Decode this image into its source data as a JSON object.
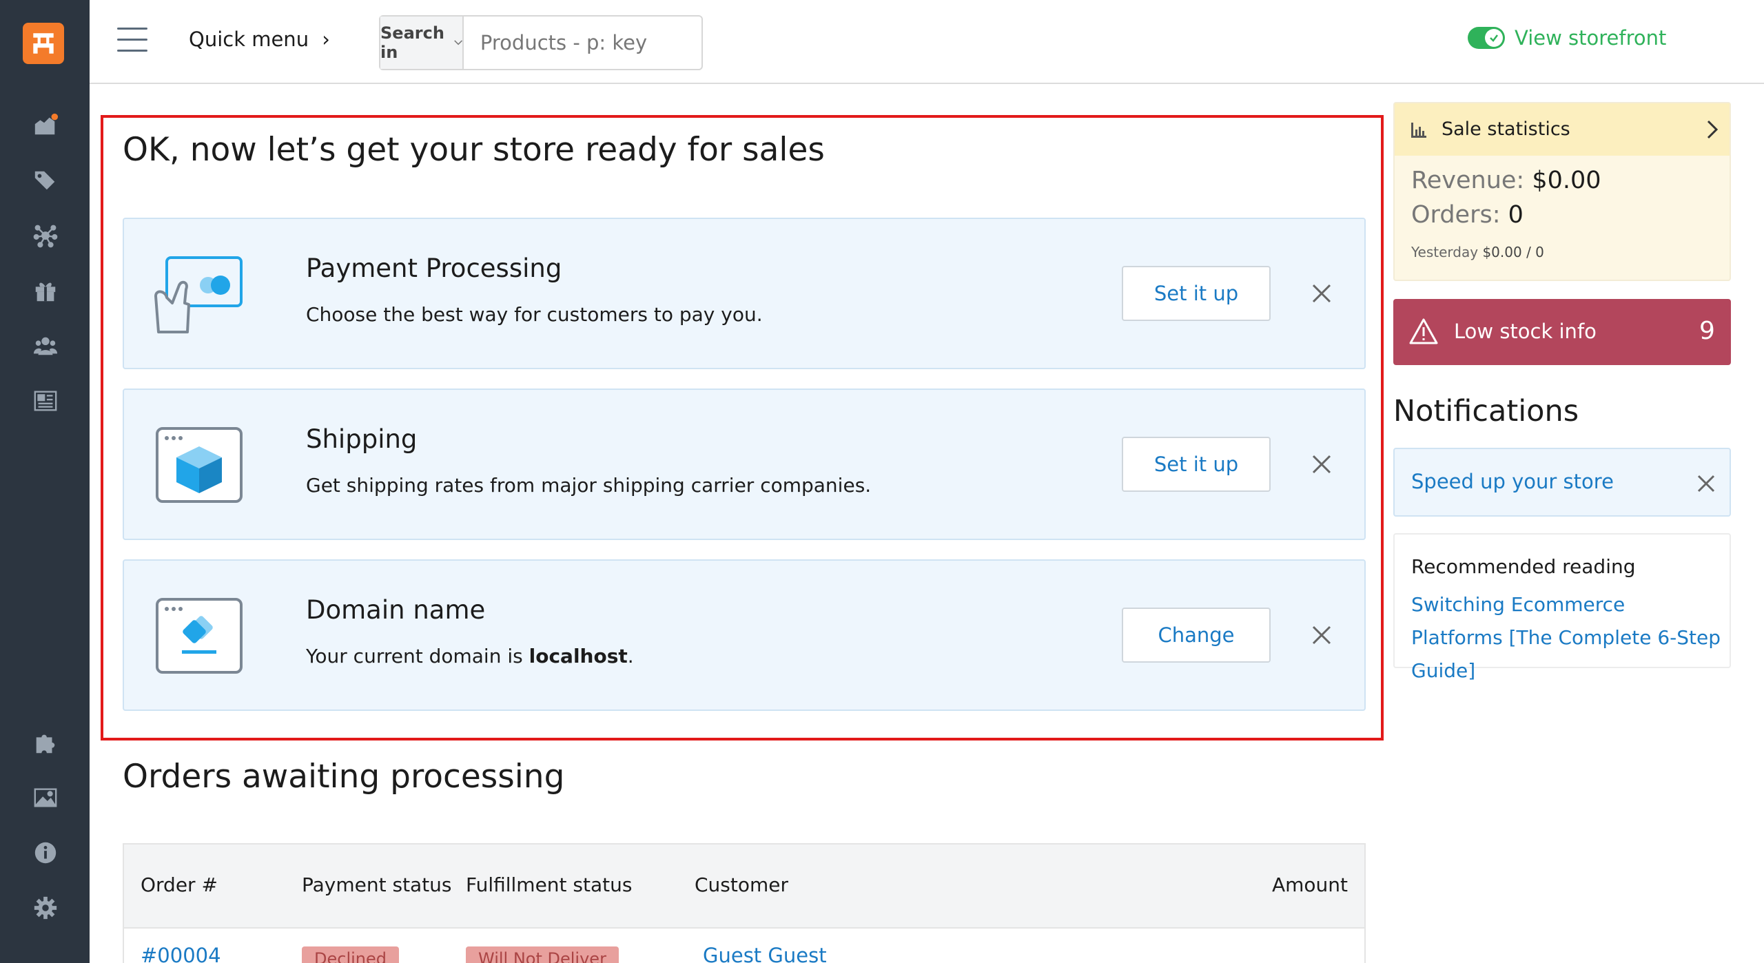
{
  "header": {
    "quick_menu": "Quick menu",
    "search_in_label": "Search in",
    "search_placeholder": "Products - p: key",
    "view_storefront": "View storefront"
  },
  "setup": {
    "title": "OK, now let’s get your store ready for sales",
    "cards": [
      {
        "title": "Payment Processing",
        "description": "Choose the best way for customers to pay you.",
        "button": "Set it up"
      },
      {
        "title": "Shipping",
        "description": "Get shipping rates from major shipping carrier companies.",
        "button": "Set it up"
      },
      {
        "title": "Domain name",
        "description_prefix": "Your current domain is ",
        "domain": "localhost",
        "description_suffix": ".",
        "button": "Change"
      }
    ]
  },
  "orders": {
    "title": "Orders awaiting processing",
    "columns": [
      "Order #",
      "Payment status",
      "Fulfillment status",
      "Customer",
      "Amount"
    ],
    "rows": [
      {
        "order": "#00004",
        "payment_status": "Declined",
        "fulfillment_status": "Will Not Deliver",
        "customer": "Guest Guest"
      }
    ]
  },
  "stats": {
    "title": "Sale statistics",
    "revenue_label": "Revenue:",
    "revenue_value": "$0.00",
    "orders_label": "Orders:",
    "orders_value": "0",
    "yesterday_label": "Yesterday",
    "yesterday_value": "$0.00 / 0"
  },
  "low_stock": {
    "label": "Low stock info",
    "count": "9"
  },
  "notifications": {
    "title": "Notifications",
    "items": [
      {
        "label": "Speed up your store"
      }
    ],
    "reading_title": "Recommended reading",
    "reading_link": "Switching Ecommerce Platforms [The Complete 6-Step Guide]"
  },
  "colors": {
    "sidebar": "#2c3540",
    "accent": "#1a7ac4",
    "logo": "#f47b2a",
    "success": "#2fb25a",
    "alert": "#b3465c",
    "highlight_frame": "#e21a1a"
  },
  "icons": {
    "sidebar_top": [
      "orders-icon",
      "products-icon",
      "catalog-icon",
      "promotions-icon",
      "customers-icon",
      "content-icon"
    ],
    "sidebar_bottom": [
      "addons-icon",
      "images-icon",
      "info-icon",
      "settings-icon"
    ]
  }
}
